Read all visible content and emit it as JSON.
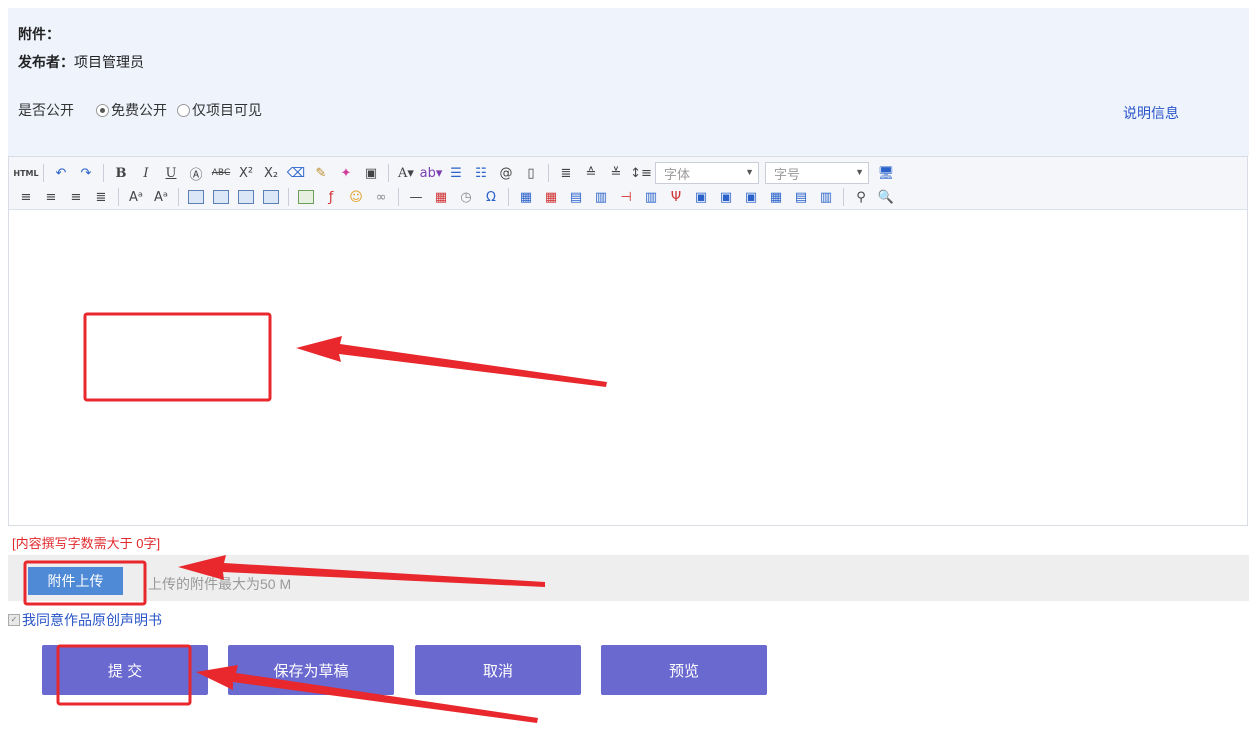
{
  "info": {
    "attachment_label": "附件：",
    "publisher_label": "发布者：",
    "publisher_value": "项目管理员",
    "public_label": "是否公开",
    "options": [
      "免费公开",
      "仅项目可见"
    ],
    "selected_option": "免费公开",
    "desc_link": "说明信息"
  },
  "toolbar": {
    "html_label": "HTML",
    "font_placeholder": "字体",
    "size_placeholder": "字号"
  },
  "warning": "[内容撰写字数需大于 0字]",
  "upload": {
    "button_label": "附件上传",
    "hint": "上传的附件最大为50 M"
  },
  "agree_text": "我同意作品原创声明书",
  "buttons": {
    "submit": "提 交",
    "save_draft": "保存为草稿",
    "cancel": "取消",
    "preview": "预览"
  },
  "colors": {
    "primary_button": "#6a69cf",
    "upload_button": "#4f8ad6",
    "annotation_red": "#e8282c",
    "link_blue": "#2a55c8"
  }
}
